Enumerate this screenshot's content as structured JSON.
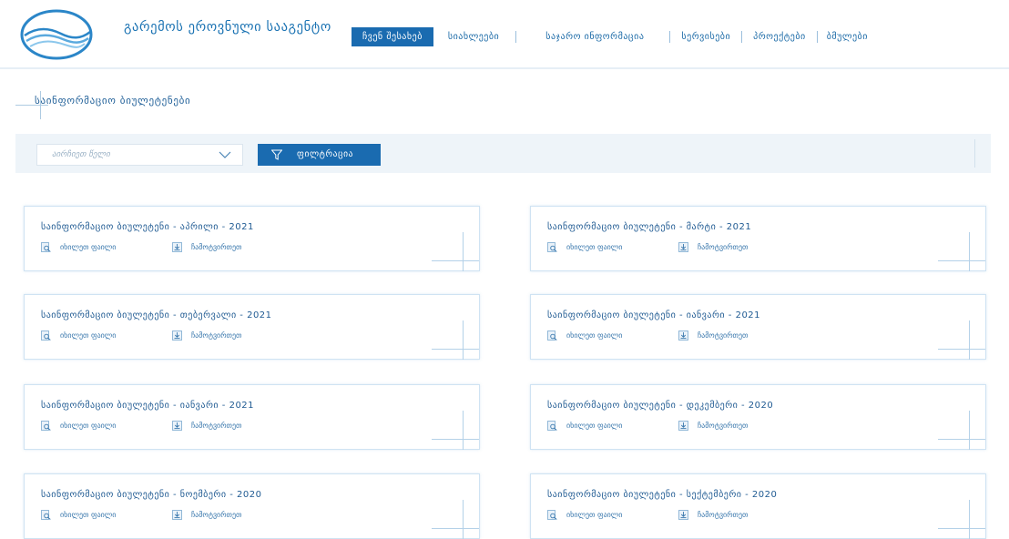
{
  "header": {
    "org_name": "გარემოს ეროვნული სააგენტო",
    "nav": [
      {
        "label": "ჩვენ შესახებ",
        "active": true
      },
      {
        "label": "სიახლეები",
        "active": false
      },
      {
        "label": "საჯარო ინფორმაცია",
        "active": false
      },
      {
        "label": "სერვისები",
        "active": false
      },
      {
        "label": "პროექტები",
        "active": false
      },
      {
        "label": "ბმულები",
        "active": false
      }
    ]
  },
  "section": {
    "title": "საინფორმაციო ბიულეტენები"
  },
  "filter": {
    "year_placeholder": "airchiet tseli",
    "year_display": "აირჩიეთ წელი",
    "button_label": "ფილტრაცია"
  },
  "cards": [
    {
      "title": "საინფორმაციო ბიულეტენი - აპრილი - 2021",
      "view_label": "იხილეთ ფაილი",
      "download_label": "ჩამოტვირთეთ"
    },
    {
      "title": "საინფორმაციო ბიულეტენი - მარტი - 2021",
      "view_label": "იხილეთ ფაილი",
      "download_label": "ჩამოტვირთეთ"
    },
    {
      "title": "საინფორმაციო ბიულეტენი - თებერვალი - 2021",
      "view_label": "იხილეთ ფაილი",
      "download_label": "ჩამოტვირთეთ"
    },
    {
      "title": "საინფორმაციო ბიულეტენი - იანვარი - 2021",
      "view_label": "იხილეთ ფაილი",
      "download_label": "ჩამოტვირთეთ"
    },
    {
      "title": "საინფორმაციო ბიულეტენი - იანვარი - 2021",
      "view_label": "იხილეთ ფაილი",
      "download_label": "ჩამოტვირთეთ"
    },
    {
      "title": "საინფორმაციო ბიულეტენი - დეკემბერი - 2020",
      "view_label": "იხილეთ ფაილი",
      "download_label": "ჩამოტვირთეთ"
    },
    {
      "title": "საინფორმაციო ბიულეტენი - ნოემბერი - 2020",
      "view_label": "იხილეთ ფაილი",
      "download_label": "ჩამოტვირთეთ"
    },
    {
      "title": "საინფორმაციო ბიულეტენი - სექტემბერი - 2020",
      "view_label": "იხილეთ ფაილი",
      "download_label": "ჩამოტვირთეთ"
    }
  ],
  "icons": {
    "logo": "agency-logo-waves-icon",
    "view": "document-magnifier-icon",
    "download": "download-tray-icon",
    "filter": "funnel-icon",
    "select": "chevron-down-icon"
  },
  "colors": {
    "brand_blue": "#1a6bb0",
    "text_blue": "#1f5a92",
    "filter_bg": "#eef4f9",
    "card_border": "#cfe3f3"
  }
}
